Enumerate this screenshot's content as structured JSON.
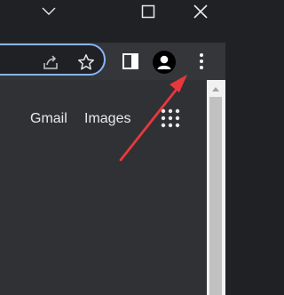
{
  "header": {
    "links": {
      "gmail": "Gmail",
      "images": "Images"
    }
  },
  "icons": {
    "minimize": "chevron-down-icon",
    "maximize": "maximize-icon",
    "close": "close-icon",
    "share": "share-icon",
    "bookmark": "star-icon",
    "side_panel": "side-panel-icon",
    "profile": "profile-avatar-icon",
    "menu": "kebab-menu-icon",
    "apps": "apps-grid-icon",
    "annotation": "red-arrow"
  },
  "colors": {
    "titlebar": "#202124",
    "toolbar": "#35363a",
    "omnibox_border": "#8ab4f8",
    "page": "#303134",
    "text": "#e8eaed",
    "annotation_arrow": "#e8383d"
  }
}
